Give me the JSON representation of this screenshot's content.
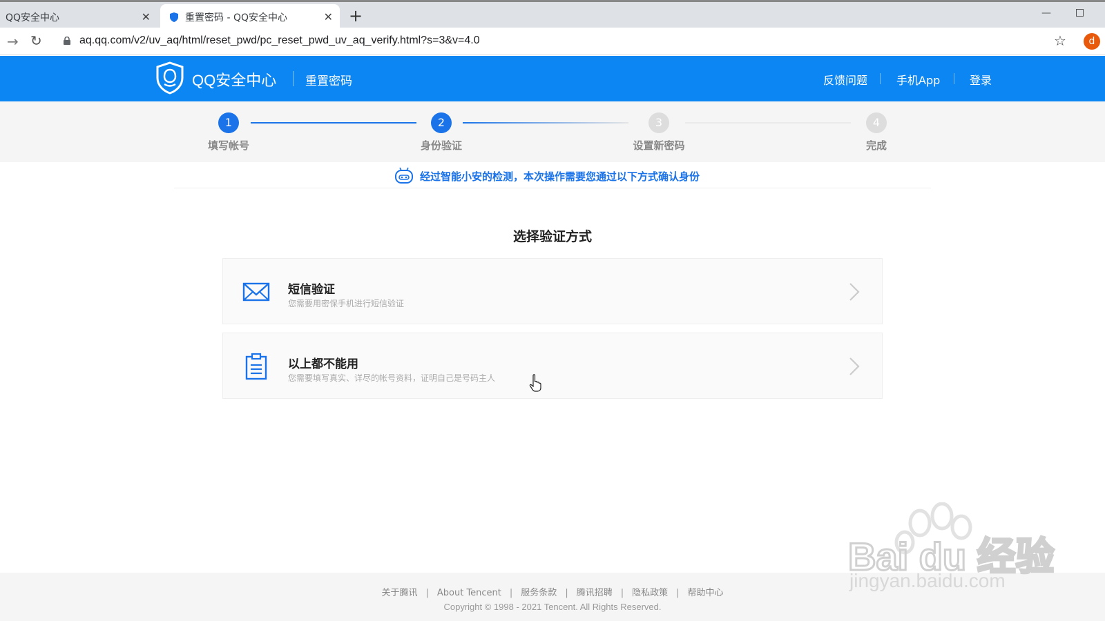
{
  "browser": {
    "tabs": [
      {
        "title": "QQ安全中心"
      },
      {
        "title": "重置密码 - QQ安全中心"
      }
    ],
    "new_tab_symbol": "+",
    "url": "aq.qq.com/v2/uv_aq/html/reset_pwd/pc_reset_pwd_uv_aq_verify.html?s=3&v=4.0",
    "profile_initial": "d"
  },
  "header": {
    "brand": "QQ安全中心",
    "subtitle": "重置密码",
    "nav": {
      "feedback": "反馈问题",
      "app": "手机App",
      "login": "登录"
    },
    "bg_color": "#0c86f2"
  },
  "steps": [
    {
      "num": "1",
      "label": "填写帐号",
      "state": "done"
    },
    {
      "num": "2",
      "label": "身份验证",
      "state": "current"
    },
    {
      "num": "3",
      "label": "设置新密码",
      "state": "pending"
    },
    {
      "num": "4",
      "label": "完成",
      "state": "pending"
    }
  ],
  "notice": "经过智能小安的检测，本次操作需要您通过以下方式确认身份",
  "section_title": "选择验证方式",
  "options": [
    {
      "title": "短信验证",
      "desc": "您需要用密保手机进行短信验证",
      "icon": "envelope-icon"
    },
    {
      "title": "以上都不能用",
      "desc": "您需要填写真实、详尽的帐号资料，证明自己是号码主人",
      "icon": "clipboard-icon"
    }
  ],
  "footer": {
    "links": [
      "关于腾讯",
      "About Tencent",
      "服务条款",
      "腾讯招聘",
      "隐私政策",
      "帮助中心"
    ],
    "copyright": "Copyright © 1998 - 2021 Tencent. All Rights Reserved."
  },
  "watermark": {
    "brand": "Bai du 经验",
    "site": "jingyan.baidu.com"
  }
}
